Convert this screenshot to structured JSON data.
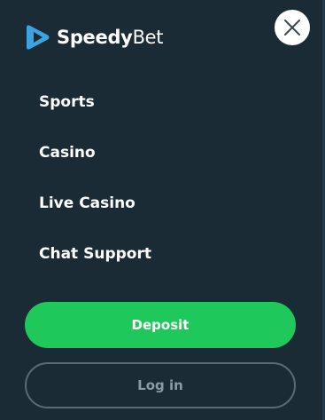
{
  "brand": {
    "name_bold": "Speedy",
    "name_regular": "Bet",
    "logo_icon": "play-triangle-logo-icon",
    "logo_color": "#3aa3e0"
  },
  "close": {
    "icon": "close-icon"
  },
  "nav": {
    "items": [
      {
        "label": "Sports"
      },
      {
        "label": "Casino"
      },
      {
        "label": "Live Casino"
      },
      {
        "label": "Chat Support"
      }
    ]
  },
  "actions": {
    "deposit_label": "Deposit",
    "login_label": "Log in"
  },
  "colors": {
    "background": "#1b2b36",
    "deposit": "#1ec85a",
    "login_border": "#5a6b76",
    "login_text": "#8c9aa4"
  }
}
